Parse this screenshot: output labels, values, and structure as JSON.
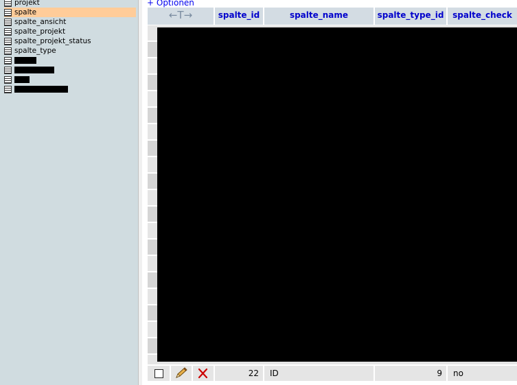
{
  "sidebar": {
    "items": [
      {
        "label": "projekt"
      },
      {
        "label": "spalte",
        "active": true
      },
      {
        "label": "spalte_ansicht"
      },
      {
        "label": "spalte_projekt"
      },
      {
        "label": "spalte_projekt_status"
      },
      {
        "label": "spalte_type"
      }
    ],
    "redacted_item_count": 4
  },
  "main": {
    "options_link": "+ Optionen",
    "columns": [
      {
        "label": "←T→"
      },
      {
        "label": "spalte_id"
      },
      {
        "label": "spalte_name"
      },
      {
        "label": "spalte_type_id"
      },
      {
        "label": "spalte_check"
      }
    ],
    "last_row": {
      "spalte_id": "22",
      "spalte_name": "ID",
      "spalte_type_id": "9",
      "spalte_check": "no"
    }
  },
  "colors": {
    "sidebar_bg": "#d0dce0",
    "active_item": "#ffcc99",
    "header_bg": "#d3dce3",
    "header_text": "#0000cc",
    "row_even": "#e5e5e5",
    "row_odd": "#d5d5d5",
    "delete_icon": "#cc0000"
  }
}
